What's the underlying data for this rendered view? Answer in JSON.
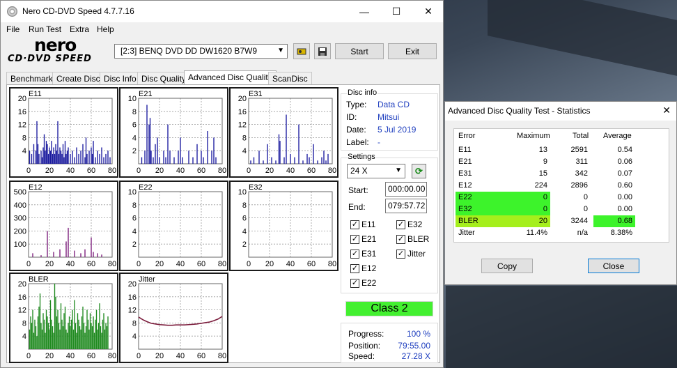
{
  "main_window": {
    "title": "Nero CD-DVD Speed 4.7.7.16",
    "controls": {
      "minimize": "—",
      "maximize": "☐",
      "close": "✕"
    },
    "menu": [
      "File",
      "Run Test",
      "Extra",
      "Help"
    ],
    "logo": {
      "brand": "nero",
      "product": "CD·DVD SPEED"
    },
    "drive": "[2:3]  BENQ DVD DD DW1620 B7W9",
    "buttons": {
      "start": "Start",
      "exit": "Exit"
    },
    "icons": {
      "drive_props": "drive-properties-icon",
      "save": "save-icon"
    },
    "tabs": [
      {
        "label": "Benchmark",
        "active": false
      },
      {
        "label": "Create Disc",
        "active": false
      },
      {
        "label": "Disc Info",
        "active": false
      },
      {
        "label": "Disc Quality",
        "active": false
      },
      {
        "label": "Advanced Disc Quality",
        "active": true
      },
      {
        "label": "ScanDisc",
        "active": false
      }
    ],
    "disc_info": {
      "title": "Disc info",
      "type_label": "Type:",
      "type": "Data CD",
      "id_label": "ID:",
      "id": "Mitsui",
      "date_label": "Date:",
      "date": "5 Jul 2019",
      "label_label": "Label:",
      "label": "-"
    },
    "settings": {
      "title": "Settings",
      "speed": "24 X",
      "start_label": "Start:",
      "start": "000:00.00",
      "end_label": "End:",
      "end": "079:57.72",
      "checkboxes": [
        {
          "label": "E11",
          "checked": true
        },
        {
          "label": "E32",
          "checked": true
        },
        {
          "label": "E21",
          "checked": true
        },
        {
          "label": "BLER",
          "checked": true
        },
        {
          "label": "E31",
          "checked": true
        },
        {
          "label": "Jitter",
          "checked": true
        },
        {
          "label": "E12",
          "checked": true
        },
        {
          "label": "E22",
          "checked": true
        }
      ]
    },
    "class_result": "Class 2",
    "progress": {
      "progress_label": "Progress:",
      "progress": "100 %",
      "position_label": "Position:",
      "position": "79:55.00",
      "speed_label": "Speed:",
      "speed": "27.28 X"
    }
  },
  "chart_data": [
    {
      "type": "bar",
      "title": "E11",
      "color": "#1a1a9e",
      "xlim": [
        0,
        80
      ],
      "ylim": [
        0,
        20
      ],
      "x_ticks": [
        "0",
        "20",
        "40",
        "60",
        "80"
      ],
      "y_ticks": [
        "20",
        "16",
        "12",
        "8",
        "4"
      ],
      "x": [
        1,
        3,
        5,
        7,
        8,
        9,
        10,
        12,
        13,
        14,
        15,
        16,
        17,
        18,
        19,
        20,
        21,
        22,
        23,
        24,
        25,
        26,
        27,
        28,
        29,
        30,
        31,
        32,
        33,
        34,
        35,
        36,
        37,
        38,
        40,
        42,
        44,
        46,
        48,
        50,
        52,
        54,
        55,
        56,
        58,
        60,
        61,
        62,
        64,
        66,
        68,
        70,
        72,
        74,
        76,
        78
      ],
      "values": [
        4,
        3,
        6,
        4,
        13,
        6,
        3,
        4,
        2,
        5,
        9,
        4,
        7,
        6,
        3,
        5,
        4,
        7,
        3,
        5,
        3,
        6,
        4,
        13,
        3,
        5,
        4,
        3,
        6,
        2,
        7,
        3,
        4,
        5,
        3,
        4,
        2,
        5,
        3,
        4,
        6,
        2,
        8,
        3,
        4,
        5,
        3,
        7,
        2,
        4,
        3,
        5,
        2,
        3,
        4,
        2
      ]
    },
    {
      "type": "bar",
      "title": "E21",
      "color": "#1a1a9e",
      "xlim": [
        0,
        80
      ],
      "ylim": [
        0,
        10
      ],
      "x_ticks": [
        "0",
        "20",
        "40",
        "60",
        "80"
      ],
      "y_ticks": [
        "10",
        "8",
        "6",
        "4",
        "2"
      ],
      "x": [
        3,
        6,
        8,
        10,
        11,
        12,
        14,
        16,
        18,
        20,
        24,
        26,
        28,
        30,
        34,
        38,
        40,
        42,
        48,
        52,
        56,
        60,
        62,
        66,
        70,
        72,
        74
      ],
      "values": [
        1,
        2,
        9,
        6,
        7,
        2,
        1,
        3,
        4,
        1,
        2,
        1,
        6,
        2,
        1,
        2,
        4,
        1,
        2,
        1,
        3,
        2,
        1,
        5,
        2,
        4,
        1
      ]
    },
    {
      "type": "bar",
      "title": "E31",
      "color": "#1a1a9e",
      "xlim": [
        0,
        80
      ],
      "ylim": [
        0,
        20
      ],
      "x_ticks": [
        "0",
        "20",
        "40",
        "60",
        "80"
      ],
      "y_ticks": [
        "20",
        "16",
        "12",
        "8",
        "4"
      ],
      "x": [
        2,
        5,
        10,
        14,
        18,
        22,
        26,
        29,
        30,
        34,
        36,
        40,
        44,
        48,
        52,
        56,
        58,
        62,
        66,
        70,
        72,
        74,
        76
      ],
      "values": [
        1,
        2,
        4,
        1,
        6,
        2,
        1,
        9,
        7,
        2,
        15,
        3,
        2,
        12,
        1,
        3,
        2,
        6,
        1,
        2,
        4,
        1,
        3
      ]
    },
    {
      "type": "bar",
      "title": "E12",
      "color": "#7a1a7a",
      "xlim": [
        0,
        80
      ],
      "ylim": [
        0,
        500
      ],
      "x_ticks": [
        "0",
        "20",
        "40",
        "60",
        "80"
      ],
      "y_ticks": [
        "500",
        "400",
        "300",
        "200",
        "100"
      ],
      "x": [
        4,
        12,
        18,
        24,
        30,
        36,
        38,
        44,
        50,
        54,
        60,
        62,
        66,
        70
      ],
      "values": [
        30,
        15,
        200,
        40,
        60,
        120,
        224,
        50,
        30,
        60,
        150,
        40,
        30,
        20
      ]
    },
    {
      "type": "bar",
      "title": "E22",
      "color": "#1a1a9e",
      "xlim": [
        0,
        80
      ],
      "ylim": [
        0,
        10
      ],
      "x_ticks": [
        "0",
        "20",
        "40",
        "60",
        "80"
      ],
      "y_ticks": [
        "10",
        "8",
        "6",
        "4",
        "2"
      ],
      "x": [],
      "values": []
    },
    {
      "type": "bar",
      "title": "E32",
      "color": "#1a1a9e",
      "xlim": [
        0,
        80
      ],
      "ylim": [
        0,
        10
      ],
      "x_ticks": [
        "0",
        "20",
        "40",
        "60",
        "80"
      ],
      "y_ticks": [
        "10",
        "8",
        "6",
        "4",
        "2"
      ],
      "x": [],
      "values": []
    },
    {
      "type": "bar",
      "title": "BLER",
      "color": "#1f8a1f",
      "xlim": [
        0,
        80
      ],
      "ylim": [
        0,
        20
      ],
      "x_ticks": [
        "0",
        "20",
        "40",
        "60",
        "80"
      ],
      "y_ticks": [
        "20",
        "16",
        "12",
        "8",
        "4"
      ],
      "x": [
        1,
        2,
        3,
        4,
        5,
        6,
        7,
        8,
        9,
        10,
        11,
        12,
        13,
        14,
        15,
        16,
        17,
        18,
        19,
        20,
        21,
        22,
        23,
        24,
        25,
        26,
        27,
        28,
        29,
        30,
        31,
        32,
        33,
        34,
        35,
        36,
        37,
        38,
        39,
        40,
        41,
        42,
        43,
        44,
        45,
        46,
        47,
        48,
        49,
        50,
        51,
        52,
        53,
        54,
        55,
        56,
        57,
        58,
        59,
        60,
        61,
        62,
        63,
        64,
        65,
        66,
        67,
        68,
        69,
        70,
        71,
        72,
        73,
        74,
        75,
        76
      ],
      "values": [
        6,
        10,
        8,
        12,
        5,
        9,
        7,
        4,
        10,
        13,
        17,
        8,
        6,
        11,
        9,
        5,
        12,
        10,
        8,
        6,
        15,
        9,
        7,
        5,
        20,
        16,
        10,
        12,
        8,
        6,
        14,
        9,
        7,
        11,
        13,
        6,
        5,
        8,
        10,
        7,
        9,
        12,
        6,
        15,
        8,
        5,
        11,
        9,
        7,
        6,
        10,
        13,
        8,
        5,
        7,
        12,
        9,
        6,
        11,
        8,
        7,
        10,
        5,
        9,
        12,
        6,
        8,
        14,
        7,
        5,
        9,
        11,
        6,
        8,
        7,
        10
      ]
    },
    {
      "type": "line",
      "title": "Jitter",
      "color": "#7a1a3a",
      "xlim": [
        0,
        80
      ],
      "ylim": [
        0,
        20
      ],
      "x_ticks": [
        "0",
        "20",
        "40",
        "60",
        "80"
      ],
      "y_ticks": [
        "20",
        "16",
        "12",
        "8",
        "4"
      ],
      "x": [
        0,
        4,
        8,
        12,
        16,
        20,
        24,
        28,
        32,
        36,
        40,
        44,
        48,
        52,
        56,
        60,
        64,
        68,
        72,
        76,
        80
      ],
      "values": [
        9.8,
        9.0,
        8.4,
        7.9,
        7.7,
        7.5,
        7.4,
        7.3,
        7.3,
        7.4,
        7.4,
        7.4,
        7.5,
        7.6,
        7.7,
        7.9,
        8.1,
        8.3,
        8.7,
        9.2,
        10.0
      ]
    }
  ],
  "stats_dialog": {
    "title": "Advanced Disc Quality Test - Statistics",
    "close_glyph": "✕",
    "headers": [
      "Error",
      "Maximum",
      "Total",
      "Average"
    ],
    "rows": [
      {
        "error": "E11",
        "maximum": "13",
        "total": "2591",
        "average": "0.54"
      },
      {
        "error": "E21",
        "maximum": "9",
        "total": "311",
        "average": "0.06"
      },
      {
        "error": "E31",
        "maximum": "15",
        "total": "342",
        "average": "0.07"
      },
      {
        "error": "E12",
        "maximum": "224",
        "total": "2896",
        "average": "0.60"
      },
      {
        "error": "E22",
        "maximum": "0",
        "total": "0",
        "average": "0.00"
      },
      {
        "error": "E32",
        "maximum": "0",
        "total": "0",
        "average": "0.00"
      },
      {
        "error": "BLER",
        "maximum": "20",
        "total": "3244",
        "average": "0.68"
      },
      {
        "error": "Jitter",
        "maximum": "11.4%",
        "total": "n/a",
        "average": "8.38%"
      }
    ],
    "buttons": {
      "copy": "Copy",
      "close": "Close"
    }
  }
}
